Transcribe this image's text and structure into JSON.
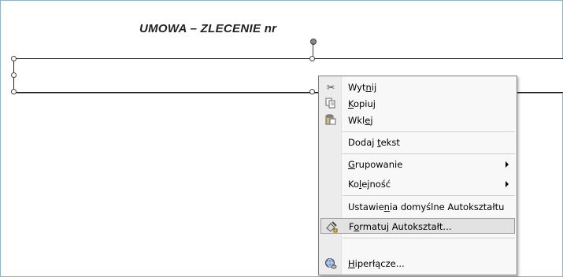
{
  "document": {
    "title": "UMOWA – ZLECENIE  nr"
  },
  "context_menu": {
    "items": [
      {
        "pre": "Wyt",
        "key": "n",
        "post": "ij",
        "icon": "scissors-icon"
      },
      {
        "pre": "",
        "key": "K",
        "post": "opiuj",
        "icon": "copy-icon"
      },
      {
        "pre": "Wkl",
        "key": "e",
        "post": "j",
        "icon": "paste-icon"
      },
      {
        "pre": "Dodaj ",
        "key": "t",
        "post": "ekst"
      },
      {
        "pre": "",
        "key": "G",
        "post": "rupowanie",
        "submenu": true
      },
      {
        "pre": "Ko",
        "key": "l",
        "post": "ejność",
        "submenu": true
      },
      {
        "pre": "Ustawie",
        "key": "n",
        "post": "ia domyślne Autokształtu"
      },
      {
        "pre": "F",
        "key": "o",
        "post": "rmatuj Autokształt...",
        "icon": "format-autoshape-icon",
        "highlighted": true
      },
      {
        "pre": "",
        "key": "H",
        "post": "iperłącze...",
        "icon": "hyperlink-globe-icon"
      }
    ]
  }
}
